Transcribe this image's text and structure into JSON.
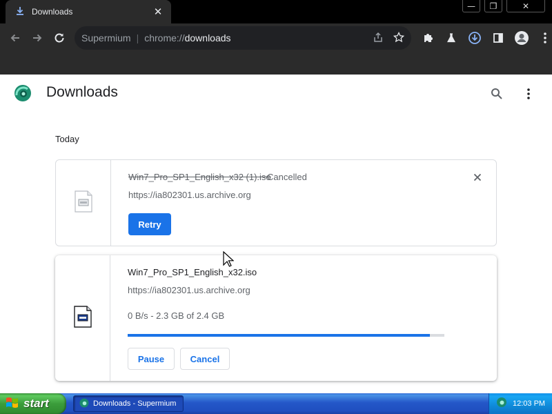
{
  "browser": {
    "tab_title": "Downloads",
    "address": {
      "site": "Supermium",
      "scheme": "chrome://",
      "path": "downloads"
    },
    "window_buttons": {
      "minimize": "—",
      "restore": "❐",
      "close": "✕"
    }
  },
  "page": {
    "title": "Downloads",
    "section_date": "Today"
  },
  "downloads": [
    {
      "filename": "Win7_Pro_SP1_English_x32 (1).iso",
      "status": "Cancelled",
      "url": "https://ia802301.us.archive.org",
      "action_label": "Retry"
    },
    {
      "filename": "Win7_Pro_SP1_English_x32.iso",
      "url": "https://ia802301.us.archive.org",
      "progress_text": "0 B/s - 2.3 GB of 2.4 GB",
      "progress_fraction": 0.955,
      "pause_label": "Pause",
      "cancel_label": "Cancel"
    }
  ],
  "taskbar": {
    "start_label": "start",
    "task_label": "Downloads - Supermium",
    "clock": "12:03 PM"
  },
  "colors": {
    "accent": "#1a73e8",
    "chrome_dark": "#2b2b2b",
    "xp_blue": "#245edb",
    "xp_green": "#3c9e3c"
  }
}
